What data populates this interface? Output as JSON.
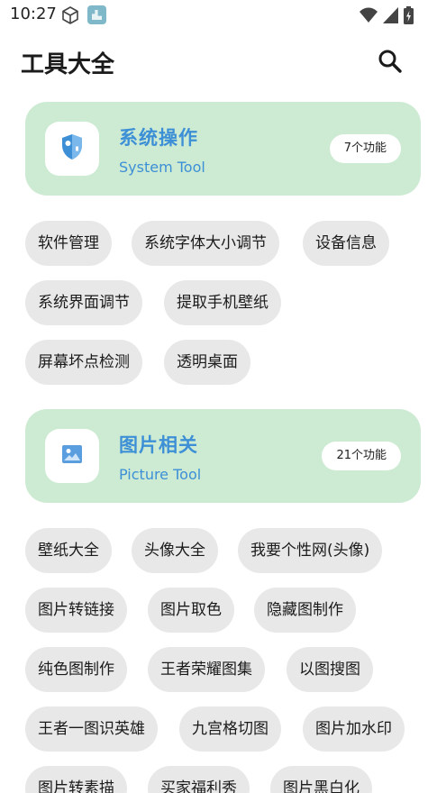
{
  "status_bar": {
    "time": "10:27"
  },
  "header": {
    "title": "工具大全"
  },
  "sections": [
    {
      "title": "系统操作",
      "subtitle": "System Tool",
      "count": "7个功能",
      "tools": [
        "软件管理",
        "系统字体大小调节",
        "设备信息",
        "系统界面调节",
        "提取手机壁纸",
        "屏幕坏点检测",
        "透明桌面"
      ]
    },
    {
      "title": "图片相关",
      "subtitle": "Picture Tool",
      "count": "21个功能",
      "tools": [
        "壁纸大全",
        "头像大全",
        "我要个性网(头像)",
        "图片转链接",
        "图片取色",
        "隐藏图制作",
        "纯色图制作",
        "王者荣耀图集",
        "以图搜图",
        "王者一图识英雄",
        "九宫格切图",
        "图片加水印",
        "图片转素描",
        "买家福利秀",
        "图片黑白化"
      ]
    }
  ],
  "colors": {
    "card_bg": "#cdebd3",
    "accent": "#3d8fd6",
    "chip_bg": "#e8e8e8"
  },
  "icons": {
    "search": "search-icon",
    "system_section": "shield-icon",
    "picture_section": "image-icon"
  }
}
